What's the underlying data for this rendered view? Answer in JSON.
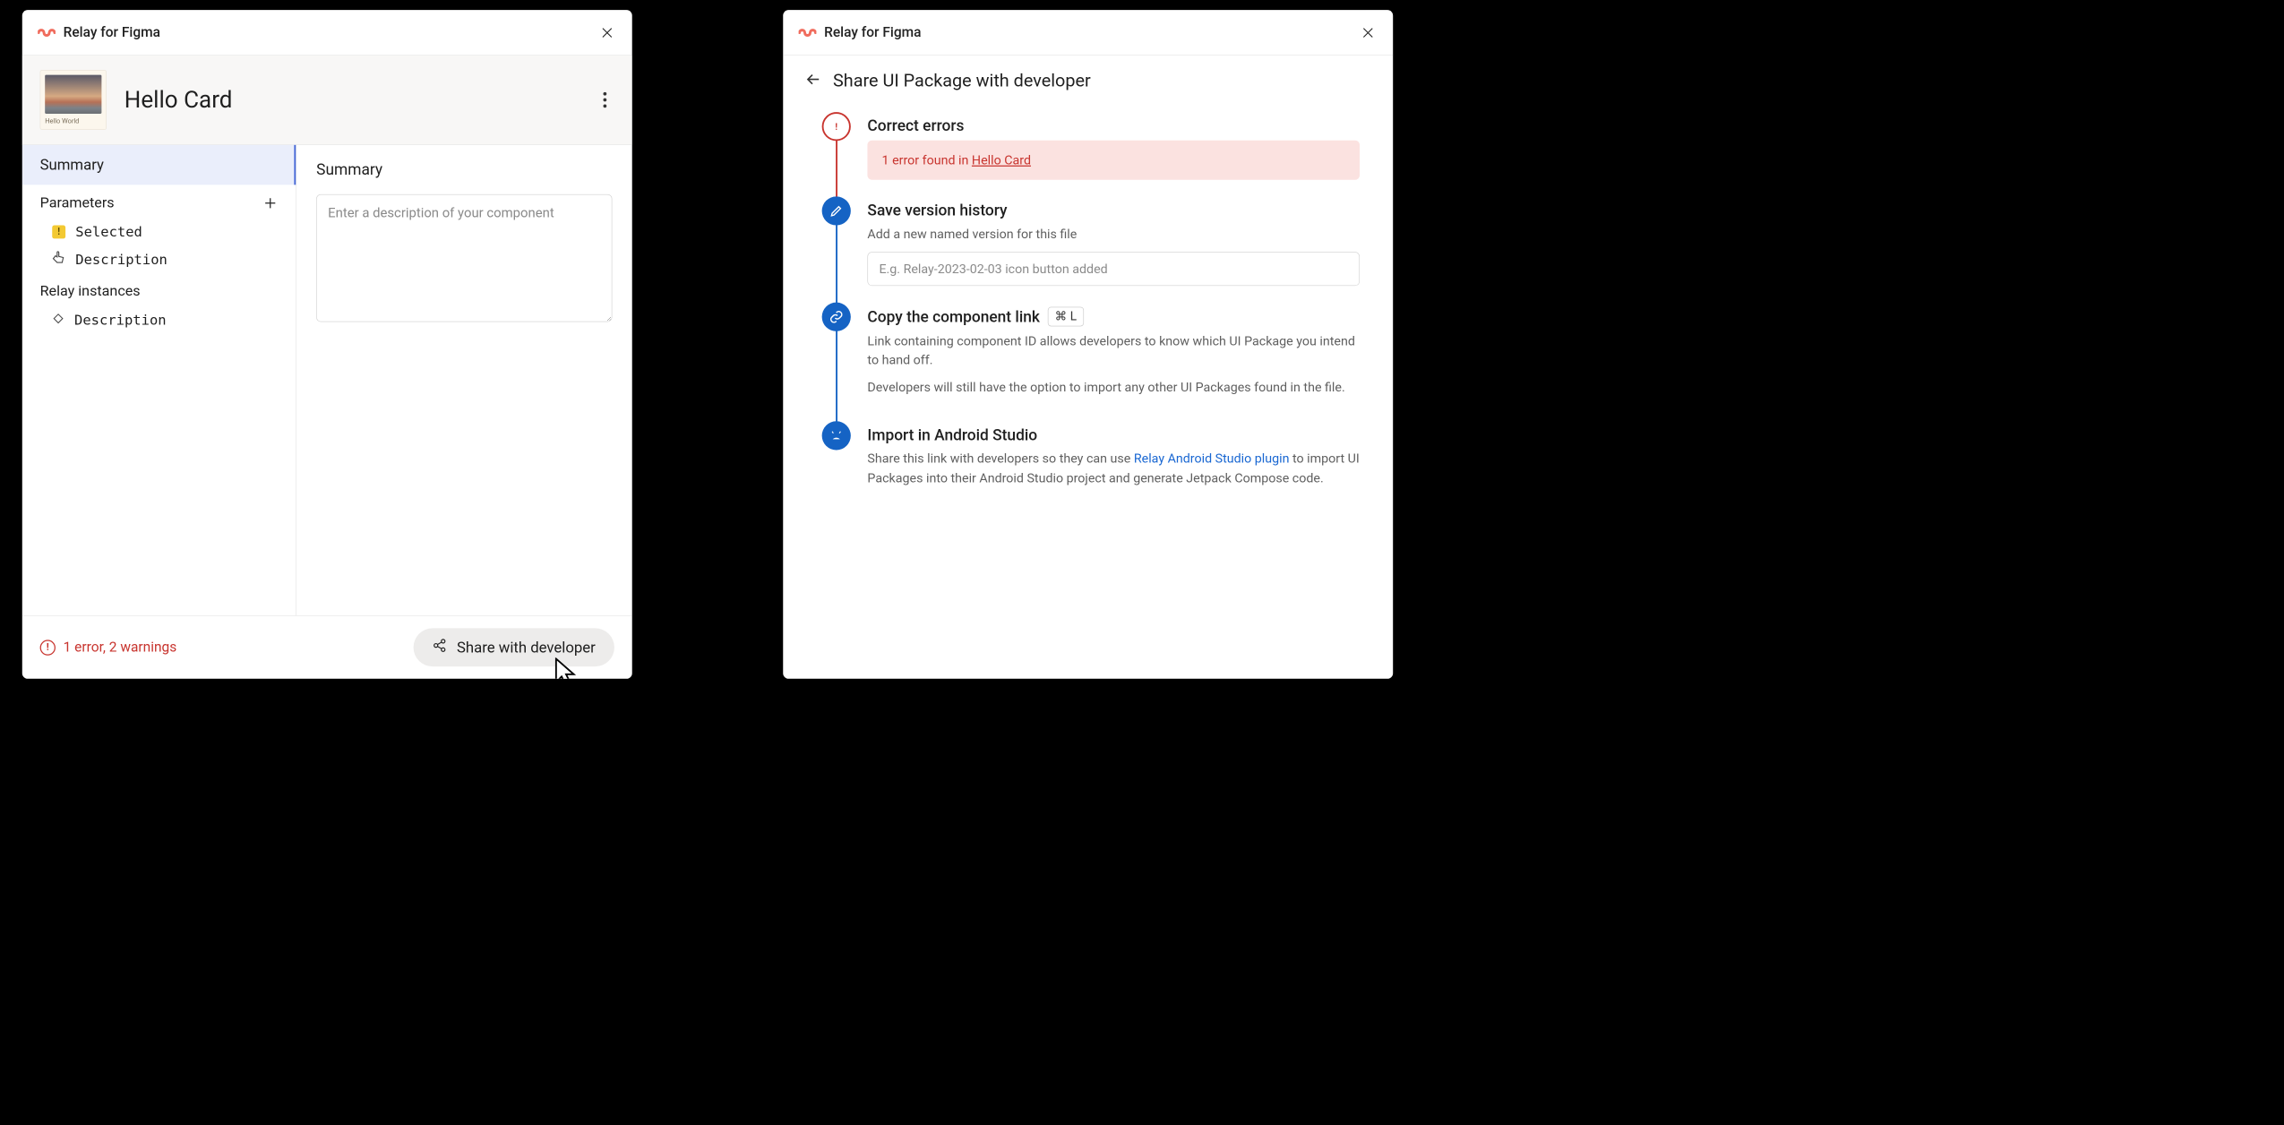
{
  "app_title": "Relay for Figma",
  "panel1": {
    "component_name": "Hello Card",
    "thumb_label": "Hello World",
    "sidebar": {
      "summary": "Summary",
      "parameters_heading": "Parameters",
      "instances_heading": "Relay instances",
      "param_selected": "Selected",
      "param_description": "Description",
      "instance_description": "Description"
    },
    "main": {
      "title": "Summary",
      "placeholder": "Enter a description of your component"
    },
    "footer": {
      "error_text": "1 error, 2 warnings",
      "share_label": "Share with developer"
    }
  },
  "panel2": {
    "title": "Share UI Package with developer",
    "step_error": {
      "title": "Correct errors",
      "panel_prefix": "1 error found in ",
      "panel_link": "Hello Card"
    },
    "step_save": {
      "title": "Save version history",
      "subtitle": "Add a new named version for this file",
      "placeholder": "E.g. Relay-2023-02-03 icon button added"
    },
    "step_copy": {
      "title": "Copy the component link",
      "kbd": "⌘ L",
      "para1": "Link containing component ID allows developers to know which UI Package you intend to hand off.",
      "para2": "Developers will still have the option to import any other UI Packages found in the file."
    },
    "step_import": {
      "title": "Import in Android Studio",
      "prefix": "Share this link with developers so they can use ",
      "link": "Relay Android Studio plugin",
      "suffix": " to import UI Packages into their Android Studio project and generate Jetpack Compose code."
    }
  }
}
